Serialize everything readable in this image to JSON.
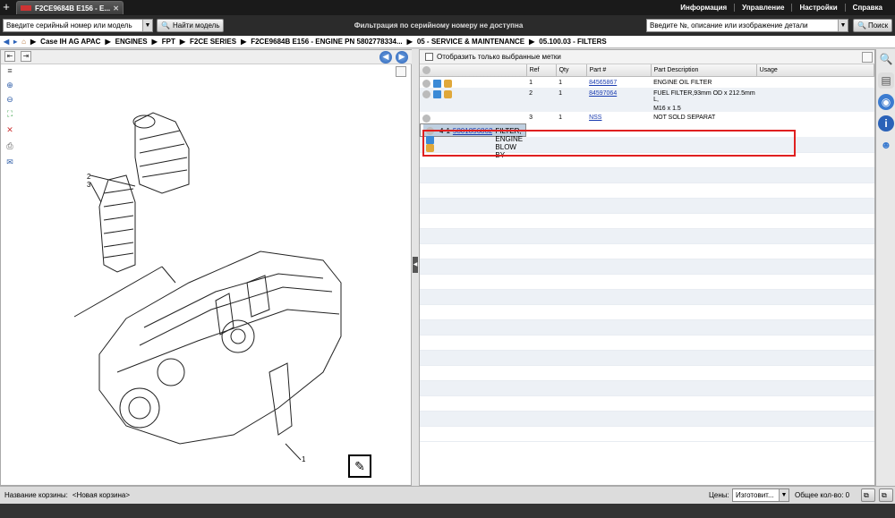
{
  "tab": {
    "title": "F2CE9684B E156 - E..."
  },
  "topmenu": [
    "Информация",
    "Управление",
    "Настройки",
    "Справка"
  ],
  "serial": {
    "placeholder": "Введите серийный номер или модель",
    "find_label": "Найти модель"
  },
  "filter_message": "Фильтрация по серийному номеру не доступна",
  "search": {
    "placeholder": "Введите №, описание или изображение детали",
    "button_label": "Поиск"
  },
  "breadcrumb": [
    "Case IH AG APAC",
    "ENGINES",
    "FPT",
    "F2CE SERIES",
    "F2CE9684B E156 - ENGINE PN 5802778334...",
    "05 - SERVICE & MAINTENANCE",
    "05.100.03 - FILTERS"
  ],
  "right": {
    "show_selected_label": "Отобразить только выбранные метки",
    "columns": [
      "Ref",
      "Qty",
      "Part #",
      "Part Description",
      "Usage"
    ],
    "rows": [
      {
        "ref": "1",
        "qty": "1",
        "part": "84565867",
        "desc": "ENGINE OIL FILTER",
        "desc2": ""
      },
      {
        "ref": "2",
        "qty": "1",
        "part": "84597064",
        "desc": "FUEL FILTER,93mm OD x 212.5mm L,",
        "desc2": "M16 x 1.5"
      },
      {
        "ref": "3",
        "qty": "1",
        "part": "NSS",
        "desc": "NOT SOLD SEPARAT",
        "desc2": ""
      },
      {
        "ref": "4",
        "qty": "1",
        "part": "5801856862",
        "desc": "FILTER, ENGINE BLOW BY",
        "desc2": ""
      }
    ]
  },
  "diagram": {
    "callouts": [
      "2",
      "3",
      "1"
    ]
  },
  "bottom": {
    "cart_label": "Название корзины:",
    "cart_value": "<Новая корзина>",
    "prices_label": "Цены:",
    "prices_value": "Изготовит...",
    "total_label": "Общее кол-во: 0"
  }
}
